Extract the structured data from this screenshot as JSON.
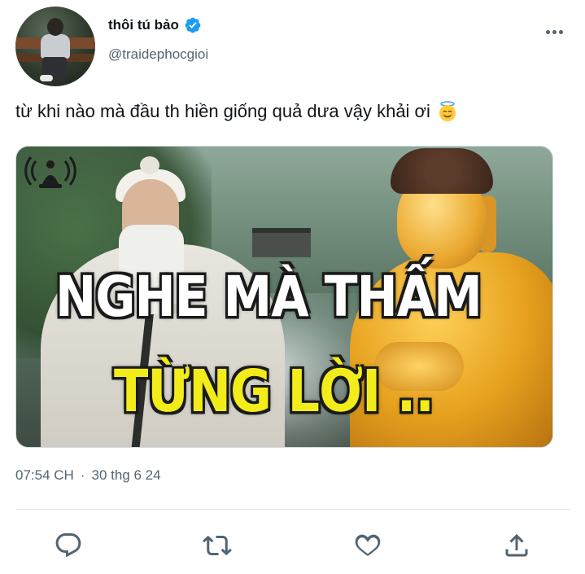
{
  "user": {
    "display_name": "thôi tú bảo",
    "handle": "@traidephocgioi",
    "verified": true,
    "verified_color": "#1d9bf0"
  },
  "tweet": {
    "text": "từ khi nào mà đầu th hiền giống quả dưa vậy khải ơi",
    "emoji": "smiling-face-with-halo",
    "time": "07:54 CH",
    "separator": "·",
    "date": "30 thg 6 24"
  },
  "media": {
    "caption_line1": "NGHE MÀ THẤM",
    "caption_line2": "TỪNG LỜI ..",
    "caption_line1_color": "#ffffff",
    "caption_line2_color": "#f2ec1b"
  },
  "actions": [
    {
      "name": "reply",
      "icon": "reply-icon"
    },
    {
      "name": "retweet",
      "icon": "retweet-icon"
    },
    {
      "name": "like",
      "icon": "heart-icon"
    },
    {
      "name": "share",
      "icon": "share-icon"
    }
  ],
  "colors": {
    "text_primary": "#0f1419",
    "text_secondary": "#536471",
    "divider": "#dfe5e8"
  }
}
